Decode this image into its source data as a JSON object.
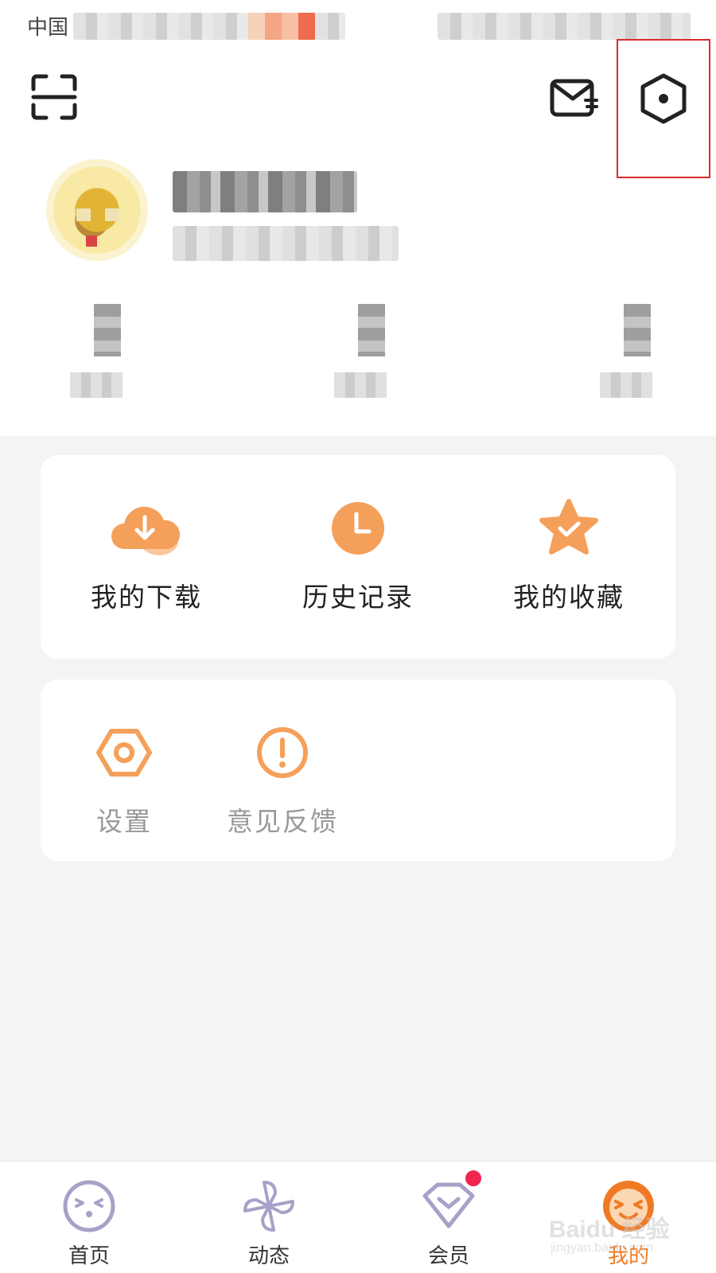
{
  "status_bar": {
    "carrier": "中国"
  },
  "header": {
    "scan_icon": "scan-icon",
    "message_icon": "mail-icon",
    "settings_icon": "settings-hexagon-icon"
  },
  "quick_actions": [
    {
      "label": "我的下载",
      "icon": "download-cloud-icon"
    },
    {
      "label": "历史记录",
      "icon": "clock-icon"
    },
    {
      "label": "我的收藏",
      "icon": "star-check-icon"
    }
  ],
  "tools": [
    {
      "label": "设置",
      "icon": "hex-nut-icon"
    },
    {
      "label": "意见反馈",
      "icon": "exclamation-circle-icon"
    }
  ],
  "bottom_nav": [
    {
      "label": "首页",
      "icon": "face-icon"
    },
    {
      "label": "动态",
      "icon": "pinwheel-icon"
    },
    {
      "label": "会员",
      "icon": "heart-diamond-icon",
      "badge": true
    },
    {
      "label": "我的",
      "icon": "smiley-icon",
      "active": true
    }
  ],
  "watermark": {
    "brand": "Baidu 经验",
    "url": "jingyan.baidu.com"
  },
  "colors": {
    "accent": "#f5a05a",
    "accent_dark": "#f07a24",
    "highlight_box": "#e02a2a",
    "badge": "#f02552",
    "nav_icon": "#a8a0c8",
    "background": "#f4f4f4"
  }
}
